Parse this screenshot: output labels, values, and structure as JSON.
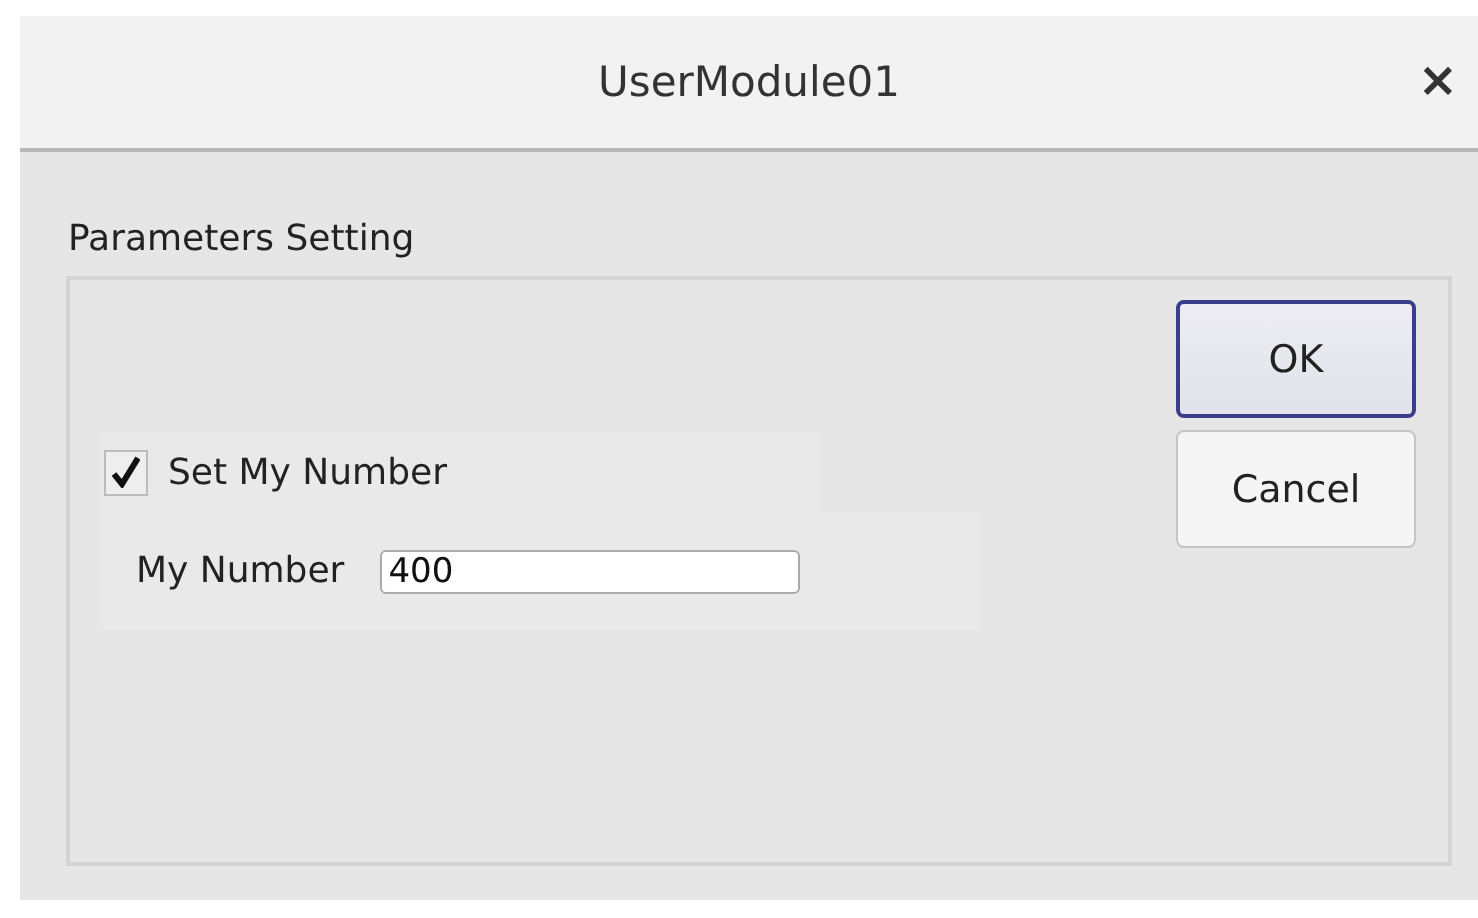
{
  "window": {
    "title": "UserModule01",
    "close": "×"
  },
  "group": {
    "label": "Parameters Setting"
  },
  "checkbox": {
    "label": "Set My Number",
    "checked": true
  },
  "field": {
    "label": "My Number",
    "value": "400"
  },
  "buttons": [
    {
      "label": "OK",
      "default": true
    },
    {
      "label": "Cancel",
      "default": false
    }
  ]
}
